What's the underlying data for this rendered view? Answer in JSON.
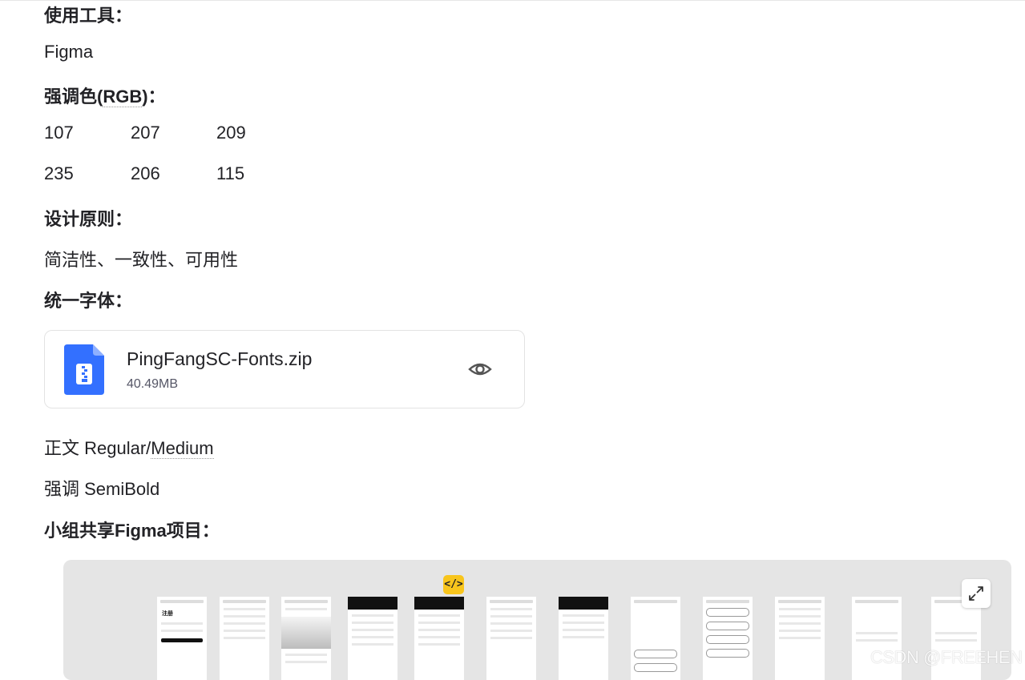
{
  "sections": {
    "tools_heading": "使用工具：",
    "tools_value": "Figma",
    "accent_heading_prefix": "强调色(",
    "accent_heading_abbr": "RGB",
    "accent_heading_suffix": ")：",
    "accent_rows": [
      [
        "107",
        "207",
        "209"
      ],
      [
        "235",
        "206",
        "115"
      ]
    ],
    "principles_heading": "设计原则：",
    "principles_value": "简洁性、一致性、可用性",
    "font_heading": "统一字体：",
    "body_font_prefix": "正文 Regular/",
    "body_font_link": "Medium",
    "emphasis_font": "强调 SemiBold",
    "figma_heading": "小组共享Figma项目："
  },
  "attachment": {
    "file_name": "PingFangSC-Fonts.zip",
    "file_size": "40.49MB",
    "icon": "zip-file-icon",
    "action_icon": "eye-icon",
    "icon_color": "#3370ff"
  },
  "figma_embed": {
    "badge_label": "</>",
    "expand_icon": "expand-icon",
    "screen_title_register": "注册",
    "background": "#e5e5e5"
  },
  "watermark": "CSDN @FREEHEN"
}
